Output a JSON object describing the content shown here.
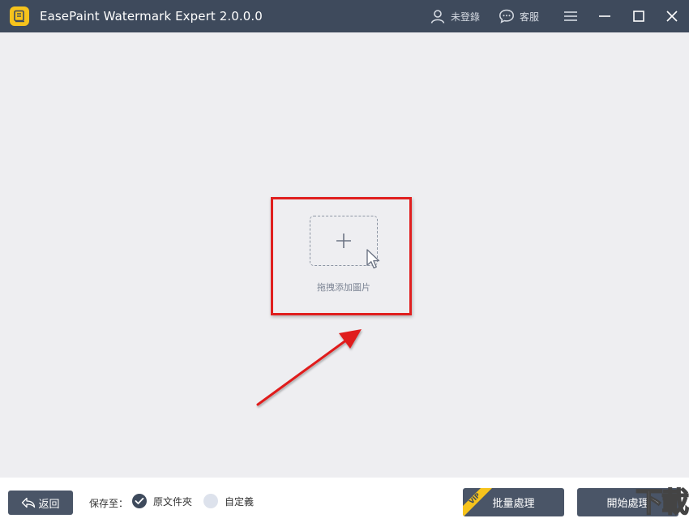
{
  "titlebar": {
    "title": "EasePaint Watermark Expert  2.0.0.0",
    "login_label": "未登錄",
    "service_label": "客服",
    "icons": {
      "logo": "app-logo-icon",
      "user": "user-icon",
      "chat": "chat-icon",
      "menu": "hamburger-menu-icon",
      "minimize": "minimize-icon",
      "maximize": "maximize-icon",
      "close": "close-icon"
    },
    "colors": {
      "bar": "#3e4a5c",
      "logo": "#f6c31c"
    }
  },
  "main": {
    "drop_label": "拖拽添加圖片",
    "icons": {
      "plus": "plus-icon",
      "cursor": "cursor-icon"
    },
    "annotation_color": "#e01f1f"
  },
  "bottombar": {
    "back_label": "返回",
    "save_to_label": "保存至：",
    "options": [
      {
        "label": "原文件夾",
        "selected": true
      },
      {
        "label": "自定義",
        "selected": false
      }
    ],
    "batch_label": "批量處理",
    "vip_badge": "VIP",
    "start_label": "開始處理",
    "watermark_text": "下載吧",
    "colors": {
      "button": "#4a5567",
      "vip": "#f6c31c"
    }
  }
}
